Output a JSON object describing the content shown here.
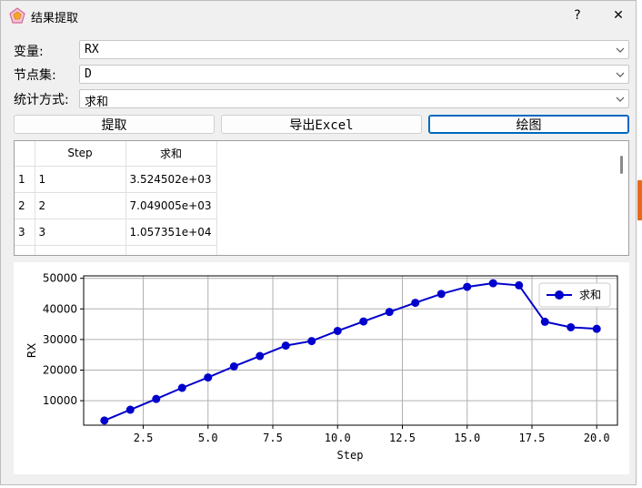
{
  "window": {
    "title": "结果提取"
  },
  "titlebar": {
    "help_label": "?",
    "close_label": "✕"
  },
  "form": {
    "variable": {
      "label": "变量:",
      "value": "RX"
    },
    "node_set": {
      "label": "节点集:",
      "value": "D"
    },
    "stat_method": {
      "label": "统计方式:",
      "value": "求和"
    }
  },
  "buttons": {
    "extract": "提取",
    "export": "导出Excel",
    "plot": "绘图"
  },
  "table": {
    "headers": [
      "Step",
      "求和"
    ],
    "rows": [
      {
        "index": "1",
        "step": "1",
        "value": "3.524502e+03"
      },
      {
        "index": "2",
        "step": "2",
        "value": "7.049005e+03"
      },
      {
        "index": "3",
        "step": "3",
        "value": "1.057351e+04"
      }
    ]
  },
  "chart_data": {
    "type": "line",
    "xlabel": "Step",
    "ylabel": "RX",
    "xlim": [
      0.2,
      20.8
    ],
    "ylim": [
      2000,
      50800
    ],
    "xticks": [
      2.5,
      5.0,
      7.5,
      10.0,
      12.5,
      15.0,
      17.5,
      20.0
    ],
    "xtick_labels": [
      "2.5",
      "5.0",
      "7.5",
      "10.0",
      "12.5",
      "15.0",
      "17.5",
      "20.0"
    ],
    "yticks": [
      10000,
      20000,
      30000,
      40000,
      50000
    ],
    "ytick_labels": [
      "10000",
      "20000",
      "30000",
      "40000",
      "50000"
    ],
    "grid": true,
    "legend": "top-right",
    "color": "#0000cc",
    "series": [
      {
        "name": "求和",
        "x": [
          1,
          2,
          3,
          4,
          5,
          6,
          7,
          8,
          9,
          10,
          11,
          12,
          13,
          14,
          15,
          16,
          17,
          18,
          19,
          20
        ],
        "y": [
          3525,
          7049,
          10574,
          14200,
          17600,
          21200,
          24600,
          28000,
          29500,
          32800,
          35900,
          39000,
          42000,
          44900,
          47200,
          48400,
          47700,
          35800,
          34000,
          33500
        ]
      }
    ]
  }
}
